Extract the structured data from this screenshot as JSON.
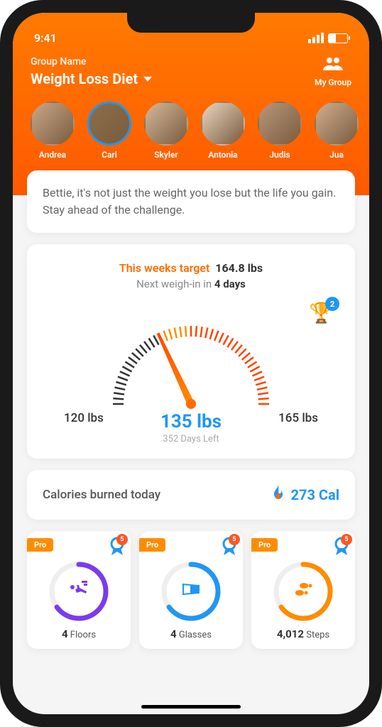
{
  "status": {
    "time": "9:41"
  },
  "header": {
    "group_label": "Group Name",
    "group_name": "Weight Loss Diet",
    "my_group_label": "My Group"
  },
  "avatars": [
    {
      "name": "Andrea",
      "active": false
    },
    {
      "name": "Carl",
      "active": true
    },
    {
      "name": "Skyler",
      "active": false
    },
    {
      "name": "Antonia",
      "active": false
    },
    {
      "name": "Judis",
      "active": false
    },
    {
      "name": "Jua",
      "active": false
    }
  ],
  "message": "Bettie, it's not just the weight you lose but the life you gain. Stay ahead of the challenge.",
  "gauge": {
    "target_label": "This weeks target",
    "target_value": "164.8 lbs",
    "weighin_prefix": "Next weigh-in in ",
    "weighin_days": "4 days",
    "trophy_badge": "2",
    "min": "120 lbs",
    "current": "135 lbs",
    "max": "165 lbs",
    "days_left": "352 Days Left"
  },
  "calories": {
    "label": "Calories burned today",
    "value": "273 Cal"
  },
  "stats": [
    {
      "pro": "Pro",
      "badge": "5",
      "value": "4",
      "unit": "Floors",
      "color": "#7c3aed",
      "icon": "🏃"
    },
    {
      "pro": "Pro",
      "badge": "5",
      "value": "4",
      "unit": "Glasses",
      "color": "#2196f3",
      "icon": "🥛"
    },
    {
      "pro": "Pro",
      "badge": "5",
      "value": "4,012",
      "unit": "Steps",
      "color": "#ff8c00",
      "icon": "👣"
    }
  ]
}
